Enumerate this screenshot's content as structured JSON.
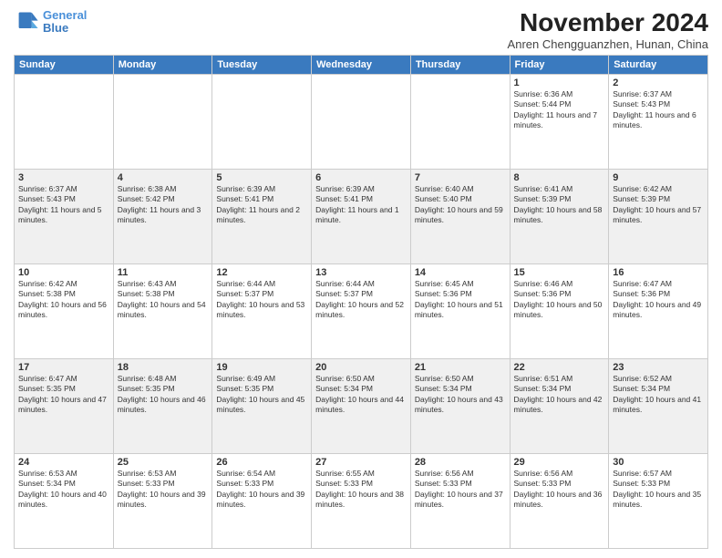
{
  "header": {
    "logo_line1": "General",
    "logo_line2": "Blue",
    "month_title": "November 2024",
    "location": "Anren Chengguanzhen, Hunan, China"
  },
  "days_of_week": [
    "Sunday",
    "Monday",
    "Tuesday",
    "Wednesday",
    "Thursday",
    "Friday",
    "Saturday"
  ],
  "weeks": [
    {
      "days": [
        {
          "num": "",
          "info": ""
        },
        {
          "num": "",
          "info": ""
        },
        {
          "num": "",
          "info": ""
        },
        {
          "num": "",
          "info": ""
        },
        {
          "num": "",
          "info": ""
        },
        {
          "num": "1",
          "info": "Sunrise: 6:36 AM\nSunset: 5:44 PM\nDaylight: 11 hours and 7 minutes."
        },
        {
          "num": "2",
          "info": "Sunrise: 6:37 AM\nSunset: 5:43 PM\nDaylight: 11 hours and 6 minutes."
        }
      ]
    },
    {
      "days": [
        {
          "num": "3",
          "info": "Sunrise: 6:37 AM\nSunset: 5:43 PM\nDaylight: 11 hours and 5 minutes."
        },
        {
          "num": "4",
          "info": "Sunrise: 6:38 AM\nSunset: 5:42 PM\nDaylight: 11 hours and 3 minutes."
        },
        {
          "num": "5",
          "info": "Sunrise: 6:39 AM\nSunset: 5:41 PM\nDaylight: 11 hours and 2 minutes."
        },
        {
          "num": "6",
          "info": "Sunrise: 6:39 AM\nSunset: 5:41 PM\nDaylight: 11 hours and 1 minute."
        },
        {
          "num": "7",
          "info": "Sunrise: 6:40 AM\nSunset: 5:40 PM\nDaylight: 10 hours and 59 minutes."
        },
        {
          "num": "8",
          "info": "Sunrise: 6:41 AM\nSunset: 5:39 PM\nDaylight: 10 hours and 58 minutes."
        },
        {
          "num": "9",
          "info": "Sunrise: 6:42 AM\nSunset: 5:39 PM\nDaylight: 10 hours and 57 minutes."
        }
      ]
    },
    {
      "days": [
        {
          "num": "10",
          "info": "Sunrise: 6:42 AM\nSunset: 5:38 PM\nDaylight: 10 hours and 56 minutes."
        },
        {
          "num": "11",
          "info": "Sunrise: 6:43 AM\nSunset: 5:38 PM\nDaylight: 10 hours and 54 minutes."
        },
        {
          "num": "12",
          "info": "Sunrise: 6:44 AM\nSunset: 5:37 PM\nDaylight: 10 hours and 53 minutes."
        },
        {
          "num": "13",
          "info": "Sunrise: 6:44 AM\nSunset: 5:37 PM\nDaylight: 10 hours and 52 minutes."
        },
        {
          "num": "14",
          "info": "Sunrise: 6:45 AM\nSunset: 5:36 PM\nDaylight: 10 hours and 51 minutes."
        },
        {
          "num": "15",
          "info": "Sunrise: 6:46 AM\nSunset: 5:36 PM\nDaylight: 10 hours and 50 minutes."
        },
        {
          "num": "16",
          "info": "Sunrise: 6:47 AM\nSunset: 5:36 PM\nDaylight: 10 hours and 49 minutes."
        }
      ]
    },
    {
      "days": [
        {
          "num": "17",
          "info": "Sunrise: 6:47 AM\nSunset: 5:35 PM\nDaylight: 10 hours and 47 minutes."
        },
        {
          "num": "18",
          "info": "Sunrise: 6:48 AM\nSunset: 5:35 PM\nDaylight: 10 hours and 46 minutes."
        },
        {
          "num": "19",
          "info": "Sunrise: 6:49 AM\nSunset: 5:35 PM\nDaylight: 10 hours and 45 minutes."
        },
        {
          "num": "20",
          "info": "Sunrise: 6:50 AM\nSunset: 5:34 PM\nDaylight: 10 hours and 44 minutes."
        },
        {
          "num": "21",
          "info": "Sunrise: 6:50 AM\nSunset: 5:34 PM\nDaylight: 10 hours and 43 minutes."
        },
        {
          "num": "22",
          "info": "Sunrise: 6:51 AM\nSunset: 5:34 PM\nDaylight: 10 hours and 42 minutes."
        },
        {
          "num": "23",
          "info": "Sunrise: 6:52 AM\nSunset: 5:34 PM\nDaylight: 10 hours and 41 minutes."
        }
      ]
    },
    {
      "days": [
        {
          "num": "24",
          "info": "Sunrise: 6:53 AM\nSunset: 5:34 PM\nDaylight: 10 hours and 40 minutes."
        },
        {
          "num": "25",
          "info": "Sunrise: 6:53 AM\nSunset: 5:33 PM\nDaylight: 10 hours and 39 minutes."
        },
        {
          "num": "26",
          "info": "Sunrise: 6:54 AM\nSunset: 5:33 PM\nDaylight: 10 hours and 39 minutes."
        },
        {
          "num": "27",
          "info": "Sunrise: 6:55 AM\nSunset: 5:33 PM\nDaylight: 10 hours and 38 minutes."
        },
        {
          "num": "28",
          "info": "Sunrise: 6:56 AM\nSunset: 5:33 PM\nDaylight: 10 hours and 37 minutes."
        },
        {
          "num": "29",
          "info": "Sunrise: 6:56 AM\nSunset: 5:33 PM\nDaylight: 10 hours and 36 minutes."
        },
        {
          "num": "30",
          "info": "Sunrise: 6:57 AM\nSunset: 5:33 PM\nDaylight: 10 hours and 35 minutes."
        }
      ]
    }
  ]
}
